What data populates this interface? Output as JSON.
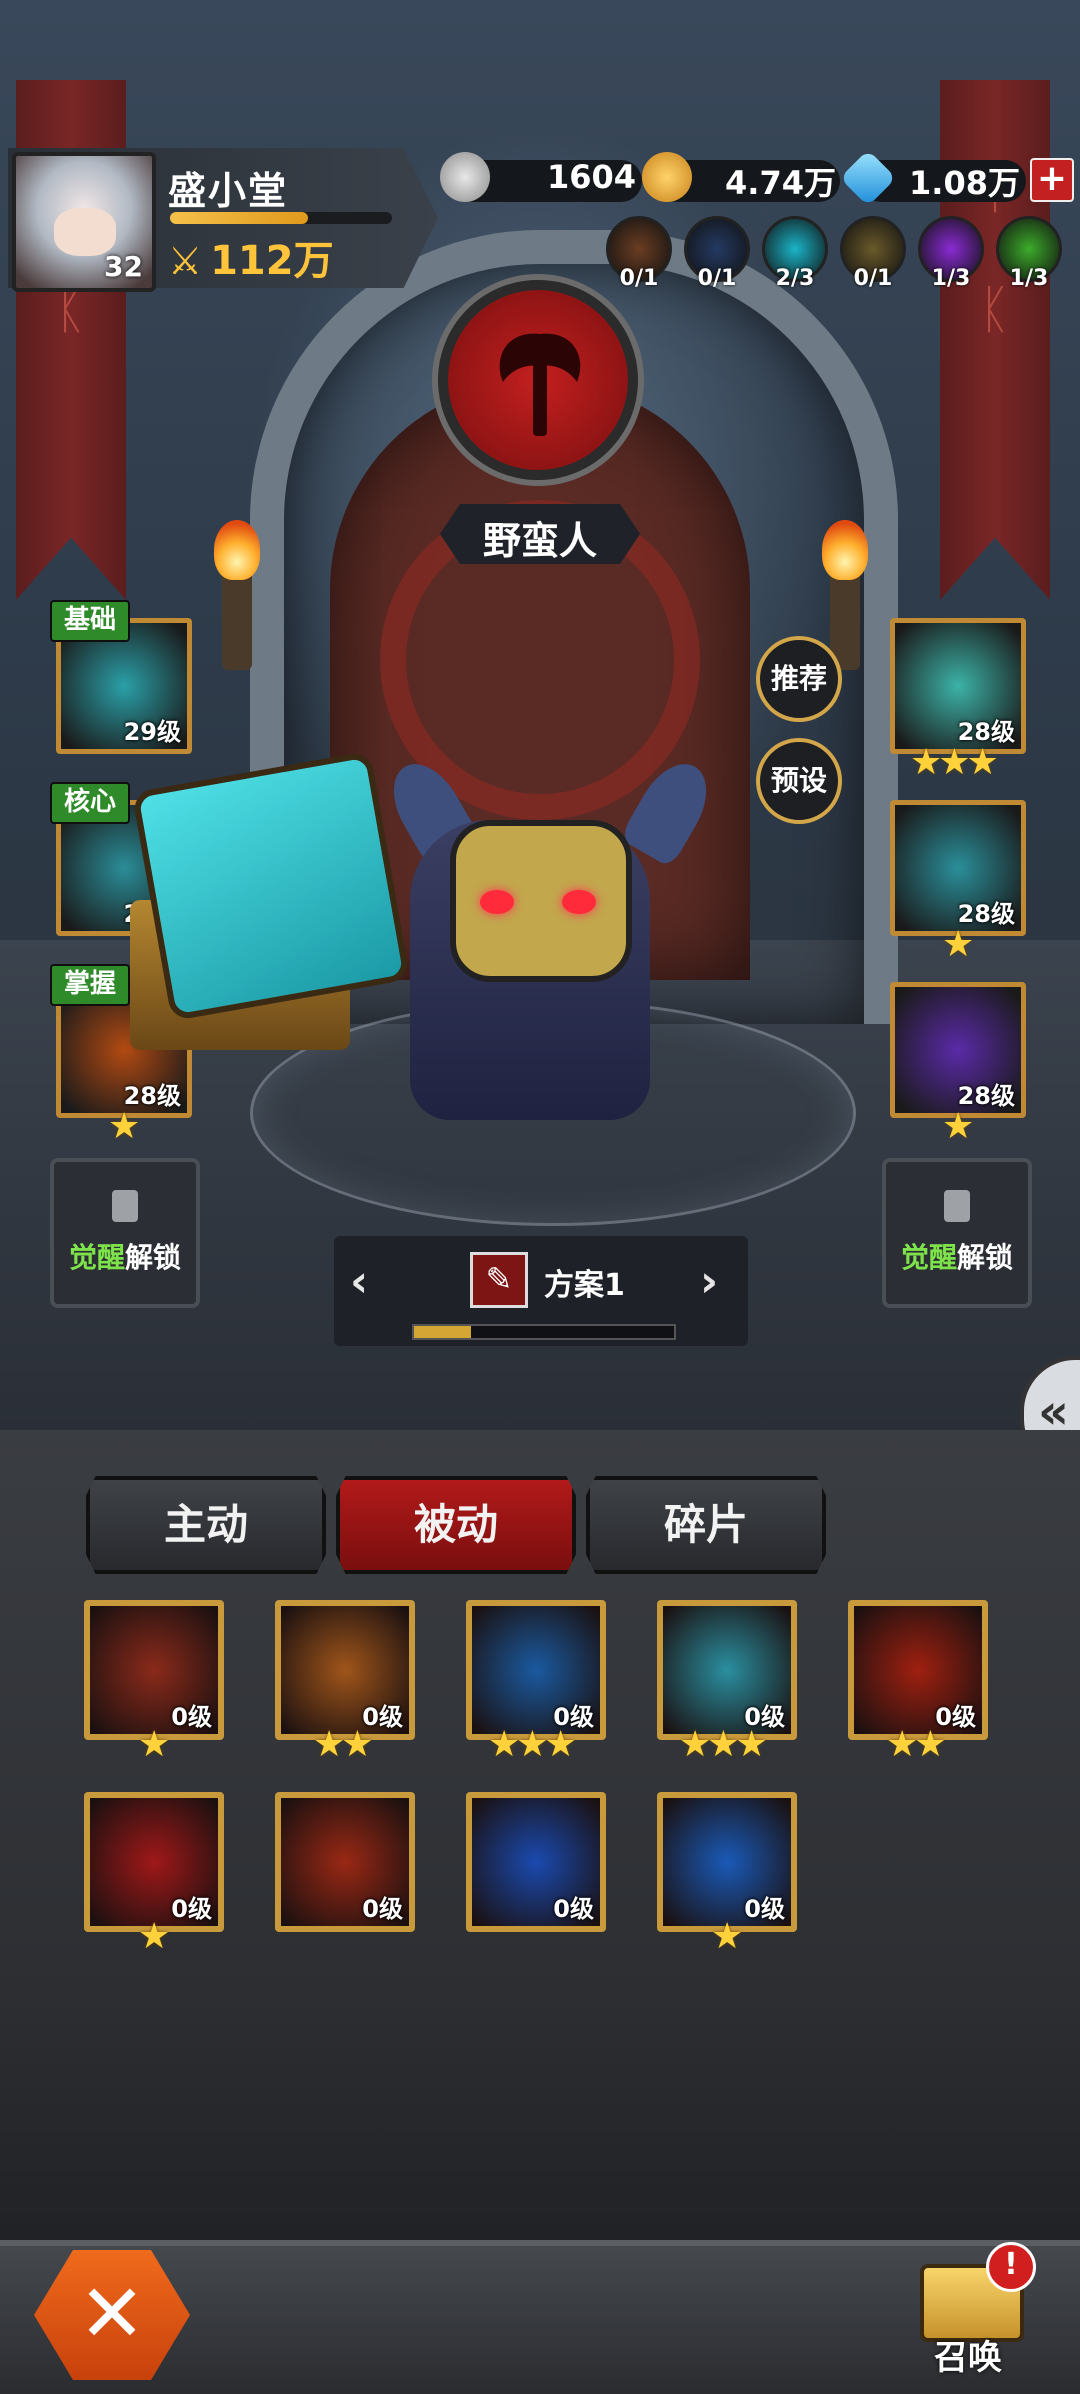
{
  "player": {
    "name": "盛小堂",
    "level": "32",
    "power": "112万",
    "xp_progress": 0.62
  },
  "currencies": [
    {
      "icon": "silver-coin-icon",
      "value": "1604",
      "color": "#c8c8c8"
    },
    {
      "icon": "gold-coin-icon",
      "value": "4.74万",
      "color": "#e7a72a"
    },
    {
      "icon": "diamond-icon",
      "value": "1.08万",
      "color": "#3fb0f0"
    }
  ],
  "elements": [
    {
      "icon": "fire-element-icon",
      "count": "0/1",
      "color": "#6b3d22"
    },
    {
      "icon": "dark-element-icon",
      "count": "0/1",
      "color": "#243a63"
    },
    {
      "icon": "ice-element-icon",
      "count": "2/3",
      "color": "#1ab4c8"
    },
    {
      "icon": "earth-element-icon",
      "count": "0/1",
      "color": "#6a5a2a"
    },
    {
      "icon": "arcane-element-icon",
      "count": "1/3",
      "color": "#8a2bd4"
    },
    {
      "icon": "nature-element-icon",
      "count": "1/3",
      "color": "#3cab2a"
    }
  ],
  "class": {
    "name": "野蛮人",
    "color": "#c41f1f"
  },
  "left_slots": [
    {
      "tag": "基础",
      "level": "29级",
      "icon": "ice-claw-icon",
      "stars": "",
      "color": "#2aa0a8"
    },
    {
      "tag": "核心",
      "level": "28级",
      "icon": "ice-swirl-icon",
      "stars": "",
      "color": "#2a8d98"
    },
    {
      "tag": "掌握",
      "level": "28级",
      "icon": "fire-burst-icon",
      "stars": "★",
      "color": "#b24a12"
    }
  ],
  "right_slots": [
    {
      "level": "28级",
      "icon": "ice-crystal-icon",
      "stars": "★★★",
      "color": "#3cb3a8"
    },
    {
      "level": "28级",
      "icon": "ice-eye-icon",
      "stars": "★",
      "color": "#2a8f9a"
    },
    {
      "level": "28级",
      "icon": "lightning-icon",
      "stars": "★",
      "color": "#5a2aa8"
    }
  ],
  "buttons": {
    "recommend": "推荐",
    "preset": "预设"
  },
  "lock": {
    "awaken": "觉醒",
    "unlock": "解锁"
  },
  "plan": {
    "name": "方案1",
    "progress": 0.22,
    "prev": "‹",
    "next": "›",
    "edit": "✎"
  },
  "tabs": [
    "主动",
    "被动",
    "碎片"
  ],
  "active_tab": "被动",
  "passive_skills": [
    {
      "icon": "sword-upgrade-icon",
      "level": "0级",
      "stars": "★",
      "color": "#8b2a1a"
    },
    {
      "icon": "shield-upgrade-icon",
      "level": "0级",
      "stars": "★★",
      "color": "#a0551a"
    },
    {
      "icon": "heart-heal-icon",
      "level": "0级",
      "stars": "★★★",
      "color": "#1a5aa0"
    },
    {
      "icon": "ice-shard-icon",
      "level": "0级",
      "stars": "★★★",
      "color": "#2a8fa0"
    },
    {
      "icon": "flame-icon",
      "level": "0级",
      "stars": "★★",
      "color": "#a02010"
    },
    {
      "icon": "fire-vortex-icon",
      "level": "0级",
      "stars": "★",
      "color": "#a01818"
    },
    {
      "icon": "fire-aura-icon",
      "level": "0级",
      "stars": "",
      "color": "#9a2814"
    },
    {
      "icon": "ice-impact-icon",
      "level": "0级",
      "stars": "",
      "color": "#1a4ab0"
    },
    {
      "icon": "lightning-shatter-icon",
      "level": "0级",
      "stars": "★",
      "color": "#1a5ab8"
    }
  ],
  "bottom": {
    "close": "✕",
    "summon": "召唤",
    "summon_badge": "!"
  },
  "plus": "+"
}
